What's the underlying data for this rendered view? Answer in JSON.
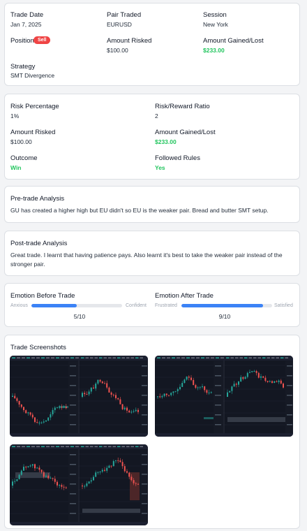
{
  "trade": {
    "date_label": "Trade Date",
    "date": "Jan 7, 2025",
    "pair_label": "Pair Traded",
    "pair": "EURUSD",
    "session_label": "Session",
    "session": "New York",
    "position_label": "Position",
    "position": "Sell",
    "amount_risked_label": "Amount Risked",
    "amount_risked": "$100.00",
    "amount_gained_label": "Amount Gained/Lost",
    "amount_gained": "$233.00",
    "strategy_label": "Strategy",
    "strategy": "SMT Divergence"
  },
  "risk": {
    "risk_pct_label": "Risk Percentage",
    "risk_pct": "1%",
    "rr_label": "Risk/Reward Ratio",
    "rr": "2",
    "amount_risked_label": "Amount Risked",
    "amount_risked": "$100.00",
    "amount_gained_label": "Amount Gained/Lost",
    "amount_gained": "$233.00",
    "outcome_label": "Outcome",
    "outcome": "Win",
    "rules_label": "Followed Rules",
    "rules": "Yes"
  },
  "pre_trade": {
    "title": "Pre-trade Analysis",
    "text": "GU has created a higher high but EU didn't so EU is the weaker pair. Bread and butter SMT setup."
  },
  "post_trade": {
    "title": "Post-trade Analysis",
    "text": "Great trade. I learnt that having patience pays. Also learnt it's best to take the weaker pair instead of the stronger pair."
  },
  "emotions": {
    "before": {
      "label": "Emotion Before Trade",
      "min_label": "Anxious",
      "max_label": "Confident",
      "score": "5/10",
      "level": 0.5
    },
    "after": {
      "label": "Emotion After Trade",
      "min_label": "Frustrated",
      "max_label": "Satisfied",
      "score": "9/10",
      "level": 0.9
    }
  },
  "screenshots": {
    "title": "Trade Screenshots"
  },
  "colors": {
    "accent": "#3b82f6",
    "sell": "#ef4444",
    "win": "#22c55e"
  }
}
